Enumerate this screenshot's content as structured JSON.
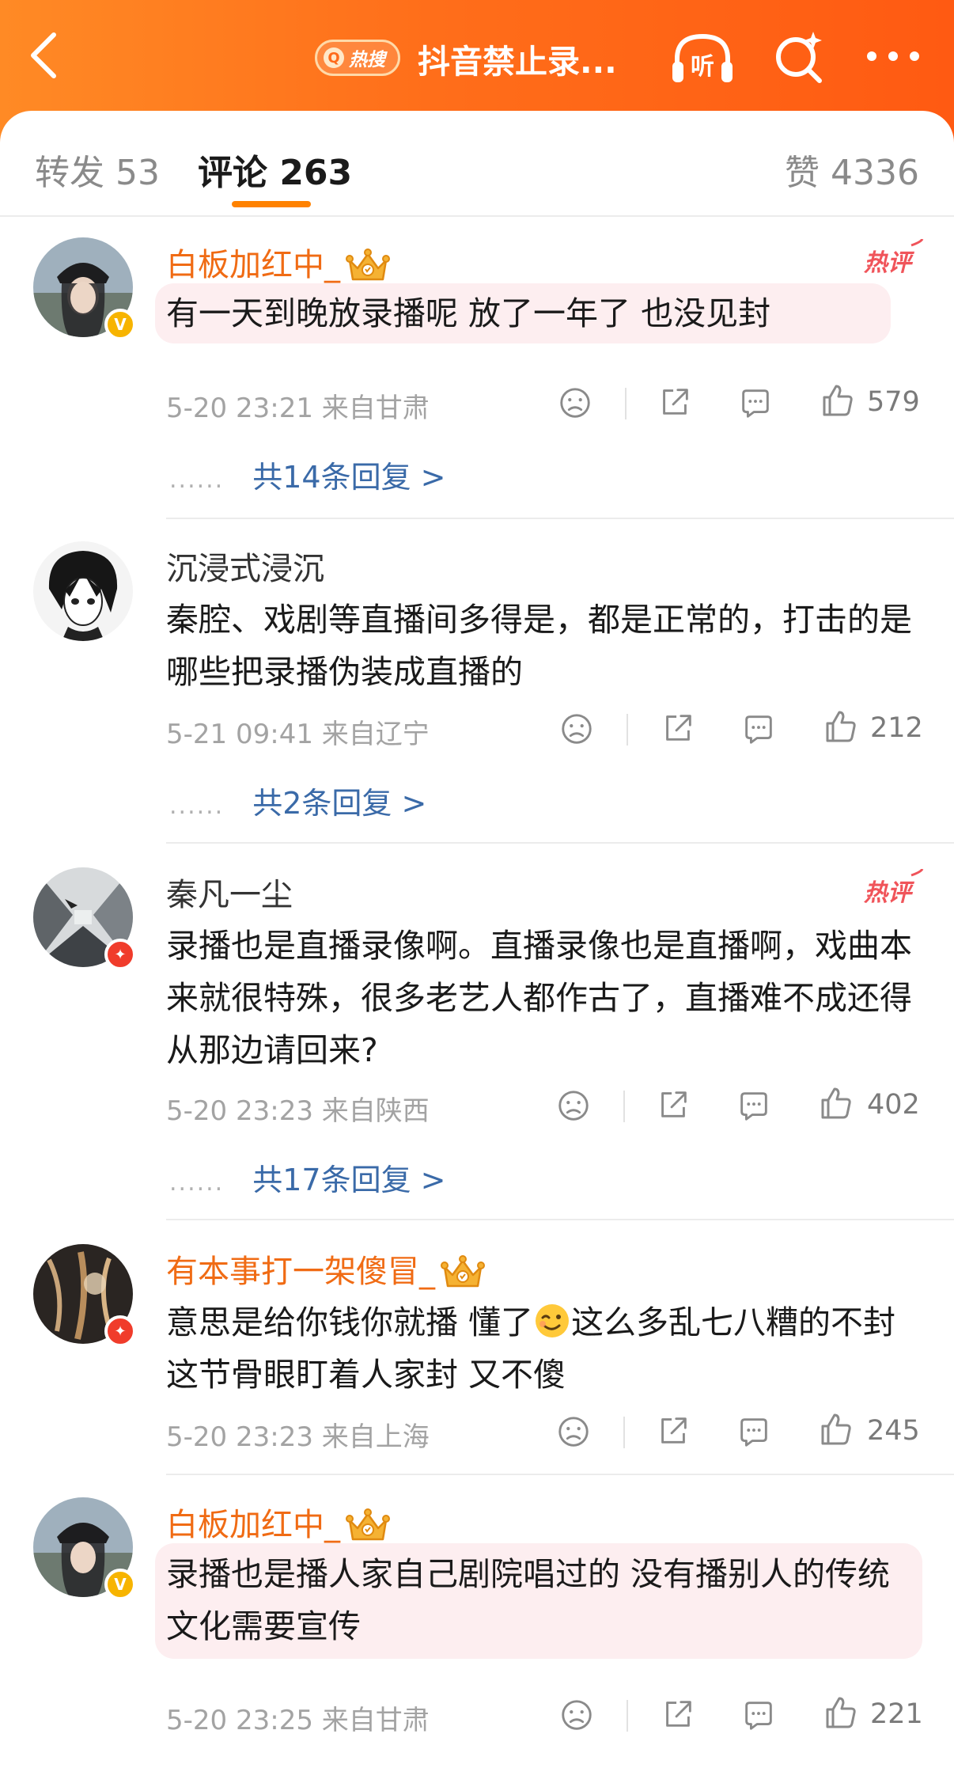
{
  "header": {
    "badge_label": "热搜",
    "title": "抖音禁止录...",
    "back_icon": "chevron-left-icon",
    "listen_label": "听",
    "gradient": [
      "#ff8a25",
      "#ff5a12"
    ]
  },
  "tabs": [
    {
      "label": "转发 53"
    },
    {
      "label": "评论 263"
    },
    {
      "label": "赞 4336"
    }
  ],
  "hot_tag_label": "热评",
  "comments": [
    {
      "user": "白板加红中_",
      "text": "有一天到晚放录播呢 放了一年了 也没见封",
      "time": "5-20 23:21 来自甘肃",
      "likes": "579",
      "replies": "共14条回复 >"
    },
    {
      "user": "沉浸式浸沉",
      "text": "秦腔、戏剧等直播间多得是，都是正常的，打击的是哪些把录播伪装成直播的",
      "time": "5-21 09:41 来自辽宁",
      "likes": "212",
      "replies": "共2条回复 >"
    },
    {
      "user": "秦凡一尘",
      "text": "录播也是直播录像啊。直播录像也是直播啊，戏曲本来就很特殊，很多老艺人都作古了，直播难不成还得从那边请回来?",
      "time": "5-20 23:23 来自陕西",
      "likes": "402",
      "replies": "共17条回复 >"
    },
    {
      "user": "有本事打一架傻冒_",
      "text_before": "意思是给你钱你就播 懂了",
      "text_after": "这么多乱七八糟的不封这节骨眼盯着人家封 又不傻",
      "time": "5-20 23:23 来自上海",
      "likes": "245"
    },
    {
      "user": "白板加红中_",
      "text": "录播也是播人家自己剧院唱过的 没有播别人的传统文化需要宣传",
      "time": "5-20 23:25 来自甘肃",
      "likes": "221"
    }
  ],
  "colors": {
    "accent": "#ff8200",
    "vip_name": "#f06b14",
    "reply_link": "#3a6aa8",
    "hot_tag": "#f0545a"
  }
}
